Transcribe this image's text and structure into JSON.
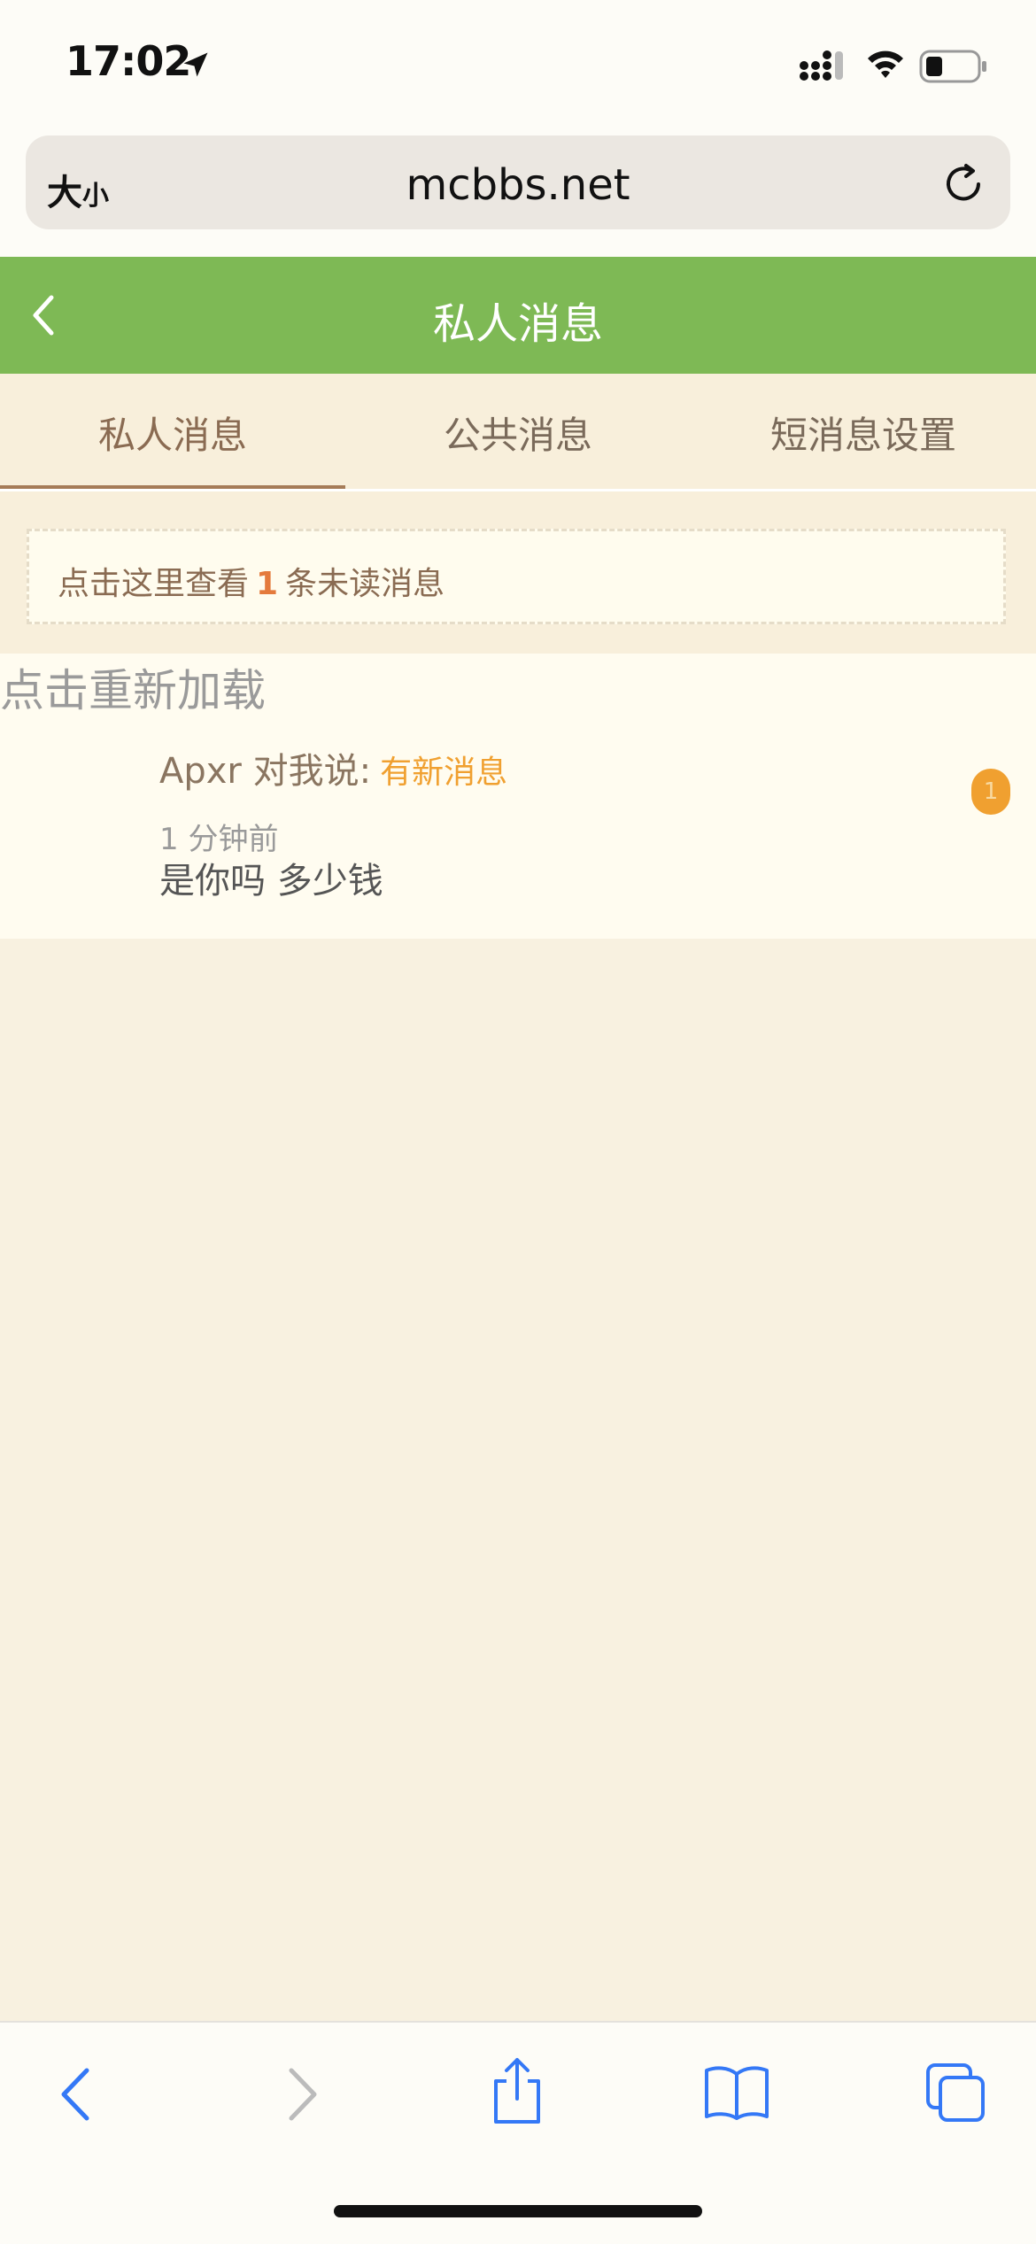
{
  "status_bar": {
    "time": "17:02"
  },
  "browser": {
    "text_size_large": "大",
    "text_size_small": "小",
    "url": "mcbbs.net"
  },
  "header": {
    "title": "私人消息"
  },
  "tabs": [
    {
      "label": "私人消息",
      "active": true
    },
    {
      "label": "公共消息",
      "active": false
    },
    {
      "label": "短消息设置",
      "active": false
    }
  ],
  "notice": {
    "prefix": "点击这里查看",
    "count": "1",
    "suffix": "条未读消息"
  },
  "reload_text": "点击重新加载",
  "messages": [
    {
      "sender_line": "Apxr 对我说:",
      "new_label": "有新消息",
      "time": "1 分钟前",
      "body": "是你吗 多少钱",
      "badge": "1"
    }
  ],
  "colors": {
    "header_green": "#7eb955",
    "page_bg": "#f8f1e0",
    "accent_orange": "#f0a030",
    "ios_blue": "#3478f6"
  },
  "toolbar_icons": [
    "back-icon",
    "forward-icon",
    "share-icon",
    "bookmarks-icon",
    "tabs-icon"
  ]
}
